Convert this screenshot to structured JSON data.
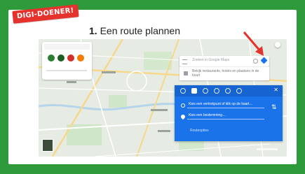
{
  "badge": {
    "text": "DIGI-DOENER!"
  },
  "title": {
    "number": "1.",
    "text": "Een route plannen"
  },
  "maps": {
    "search_placeholder": "Zoeken in Google Maps",
    "suggestion_text": "Bekijk restaurants, hotels en plaatsen in de buurt",
    "directions": {
      "start_placeholder": "Kies een vertrekpunt of klik op de kaart…",
      "destination_placeholder": "Kies een bestemming…",
      "options_label": "Routeopties",
      "close_symbol": "✕",
      "swap_symbol": "⇅",
      "modes": [
        "best-route-icon",
        "car-icon",
        "transit-icon",
        "walk-icon",
        "bicycle-icon",
        "flight-icon"
      ]
    },
    "transport_colors": [
      "#2e7d32",
      "#1b5e20",
      "#d32f2f",
      "#f57c00"
    ]
  },
  "colors": {
    "frame": "#2f9a3c",
    "badge": "#e5322c",
    "directions_panel": "#1a73e8",
    "arrow": "#e5322c"
  }
}
